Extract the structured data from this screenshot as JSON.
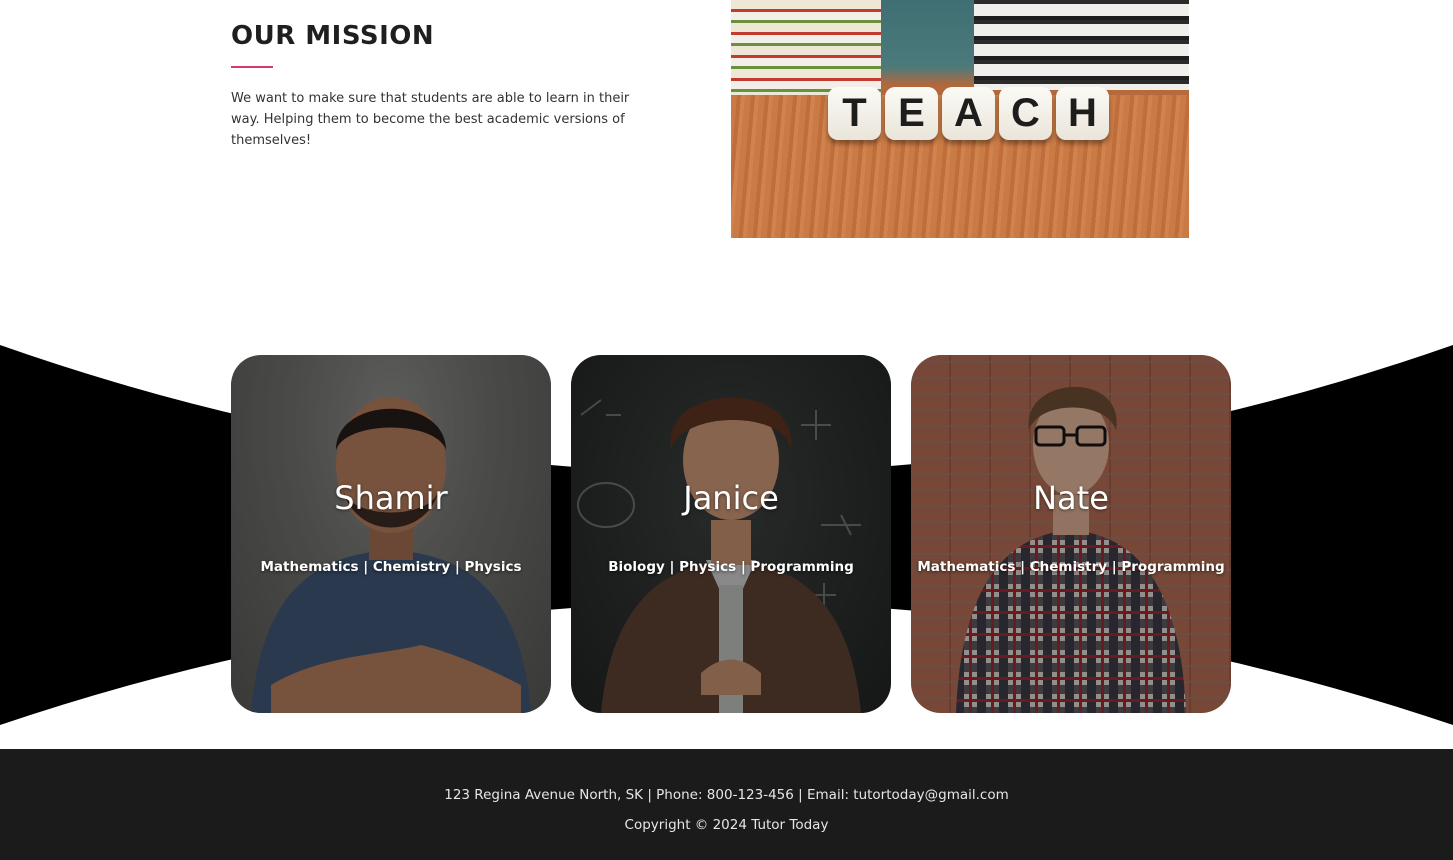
{
  "mission": {
    "title": "OUR MISSION",
    "description": "We want to make sure that students are able to learn in their way. Helping them to become the best academic versions of themselves!",
    "accent_color": "#d63a6d",
    "image_letters": [
      "T",
      "E",
      "A",
      "C",
      "H"
    ]
  },
  "tutors": [
    {
      "name": "Shamir",
      "subjects": "Mathematics | Chemistry | Physics"
    },
    {
      "name": "Janice",
      "subjects": "Biology | Physics | Programming"
    },
    {
      "name": "Nate",
      "subjects": "Mathematics | Chemistry | Programming"
    }
  ],
  "footer": {
    "contact": "123 Regina Avenue North, SK | Phone: 800-123-456 | Email: tutortoday@gmail.com",
    "copyright": "Copyright © 2024 Tutor Today",
    "background_color": "#1b1b1b"
  }
}
